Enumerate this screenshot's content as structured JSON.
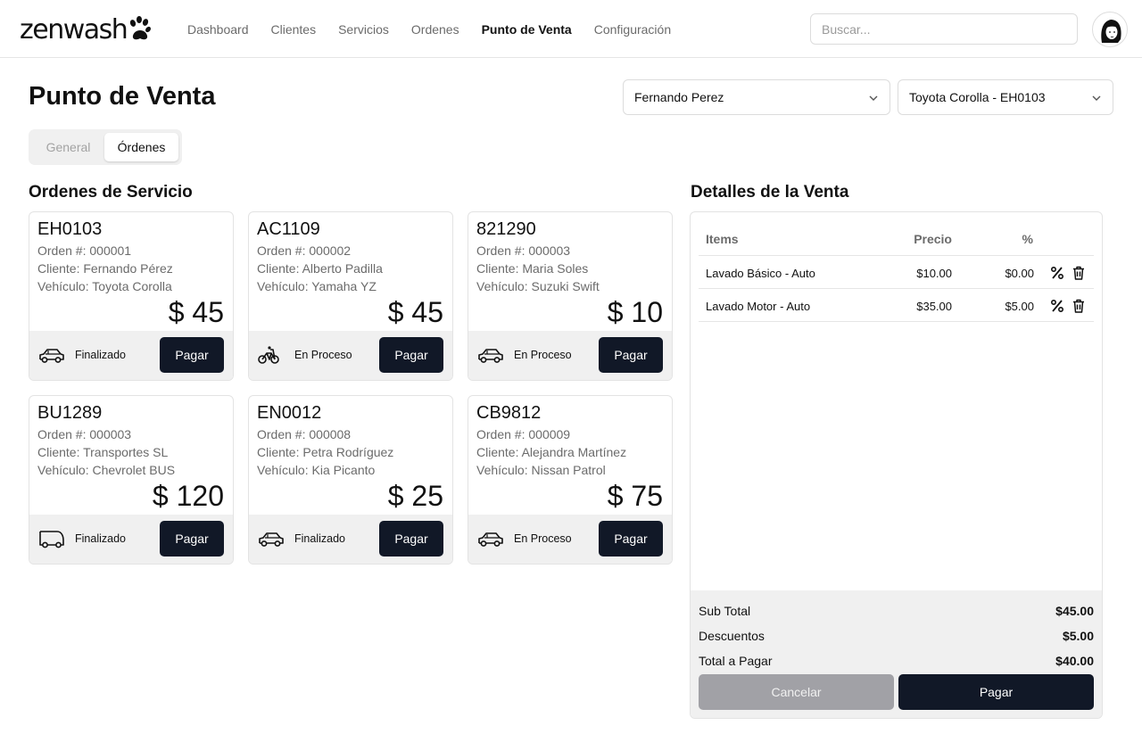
{
  "header": {
    "logo_text": "zenwash",
    "nav": [
      "Dashboard",
      "Clientes",
      "Servicios",
      "Ordenes",
      "Punto de Venta",
      "Configuración"
    ],
    "active_nav": "Punto de Venta",
    "search_placeholder": "Buscar..."
  },
  "page": {
    "title": "Punto de Venta",
    "client_select": "Fernando Perez",
    "vehicle_select": "Toyota Corolla - EH0103",
    "tabs": [
      "General",
      "Órdenes"
    ],
    "active_tab": "Órdenes"
  },
  "orders": {
    "title": "Ordenes de Servicio",
    "pay_label": "Pagar",
    "items": [
      {
        "plate": "EH0103",
        "order": "Orden #: 000001",
        "client": "Cliente: Fernando Pérez",
        "vehicle": "Vehículo: Toyota Corolla",
        "price": "$ 45",
        "status": "Finalizado",
        "icon": "car-icon"
      },
      {
        "plate": "AC1109",
        "order": "Orden #: 000002",
        "client": "Cliente: Alberto Padilla",
        "vehicle": "Vehículo: Yamaha YZ",
        "price": "$ 45",
        "status": "En Proceso",
        "icon": "motorcycle-icon"
      },
      {
        "plate": "821290",
        "order": "Orden #: 000003",
        "client": "Cliente: Maria Soles",
        "vehicle": "Vehículo: Suzuki Swift",
        "price": "$ 10",
        "status": "En Proceso",
        "icon": "car-icon"
      },
      {
        "plate": "BU1289",
        "order": "Orden #: 000003",
        "client": "Cliente: Transportes SL",
        "vehicle": "Vehículo: Chevrolet BUS",
        "price": "$ 120",
        "status": "Finalizado",
        "icon": "van-icon"
      },
      {
        "plate": "EN0012",
        "order": "Orden #: 000008",
        "client": "Cliente: Petra Rodríguez",
        "vehicle": "Vehículo: Kia Picanto",
        "price": "$ 25",
        "status": "Finalizado",
        "icon": "car-icon"
      },
      {
        "plate": "CB9812",
        "order": "Orden #: 000009",
        "client": "Cliente: Alejandra Martínez",
        "vehicle": "Vehículo: Nissan Patrol",
        "price": "$ 75",
        "status": "En Proceso",
        "icon": "car-icon"
      }
    ]
  },
  "details": {
    "title": "Detalles de la Venta",
    "columns": {
      "items": "Items",
      "price": "Precio",
      "discount": "%"
    },
    "rows": [
      {
        "item": "Lavado Básico - Auto",
        "price": "$10.00",
        "discount": "$0.00"
      },
      {
        "item": "Lavado Motor - Auto",
        "price": "$35.00",
        "discount": "$5.00"
      }
    ],
    "subtotal_label": "Sub Total",
    "subtotal": "$45.00",
    "discounts_label": "Descuentos",
    "discounts": "$5.00",
    "total_label": "Total a Pagar",
    "total": "$40.00",
    "cancel_label": "Cancelar",
    "pay_label": "Pagar"
  },
  "colors": {
    "primary": "#111827",
    "muted": "#a1a1a6",
    "panel_gray": "#f0f0f0"
  }
}
